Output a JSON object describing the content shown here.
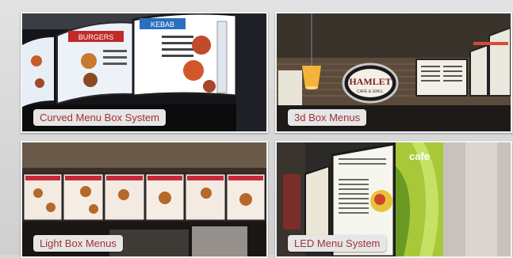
{
  "gallery": {
    "tiles": [
      {
        "caption": "Curved Menu Box System",
        "sign_text": [
          "BURGERS",
          "KEBAB"
        ]
      },
      {
        "caption": "3d Box Menus",
        "sign_text": [
          "HAMLET",
          "CAFE & GRILL"
        ]
      },
      {
        "caption": "Light Box Menus"
      },
      {
        "caption": "LED Menu System",
        "sign_text": [
          "cafe"
        ]
      }
    ]
  },
  "colors": {
    "caption_text": "#a03232",
    "caption_bg": "#e6e6e6",
    "tile_border": "#f2f2f2"
  }
}
